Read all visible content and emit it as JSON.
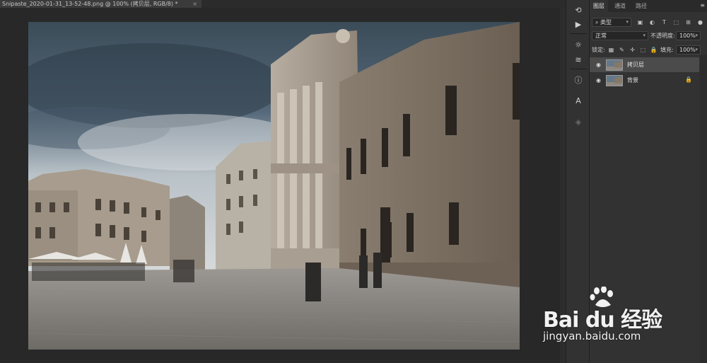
{
  "document": {
    "tab_title": "Snipaste_2020-01-31_13-52-48.png @ 100% (拷贝层, RGB/8) *",
    "close_glyph": "×"
  },
  "toolstrip": {
    "tools": [
      {
        "name": "history-icon",
        "glyph": "⟲"
      },
      {
        "name": "play-icon",
        "glyph": "▶"
      },
      {
        "name": "brush-settings-icon",
        "glyph": "☼"
      },
      {
        "name": "clone-source-icon",
        "glyph": "≋"
      },
      {
        "name": "info-icon",
        "glyph": "ⓘ"
      },
      {
        "name": "character-icon",
        "glyph": "A"
      },
      {
        "name": "3d-icon",
        "glyph": "◈"
      }
    ]
  },
  "layers_panel": {
    "tabs": [
      {
        "label": "图层",
        "active": true
      },
      {
        "label": "通道",
        "active": false
      },
      {
        "label": "路径",
        "active": false
      }
    ],
    "menu_glyph": "≡",
    "filter": {
      "label": "类型",
      "search_glyph": "⌕"
    },
    "filter_icons": [
      "▣",
      "◐",
      "T",
      "⬚",
      "⊞",
      "●"
    ],
    "blend_mode": "正常",
    "opacity": {
      "label": "不透明度:",
      "value": "100%"
    },
    "lock_label": "锁定:",
    "lock_icons": [
      "▦",
      "✎",
      "✛",
      "⬚",
      "🔒"
    ],
    "fill": {
      "label": "填充:",
      "value": "100%"
    },
    "layers": [
      {
        "name": "拷贝层",
        "selected": true,
        "locked": false
      },
      {
        "name": "背景",
        "selected": false,
        "locked": true
      }
    ]
  },
  "watermark": {
    "brand": "Bai du 经验",
    "url": "jingyan.baidu.com"
  }
}
